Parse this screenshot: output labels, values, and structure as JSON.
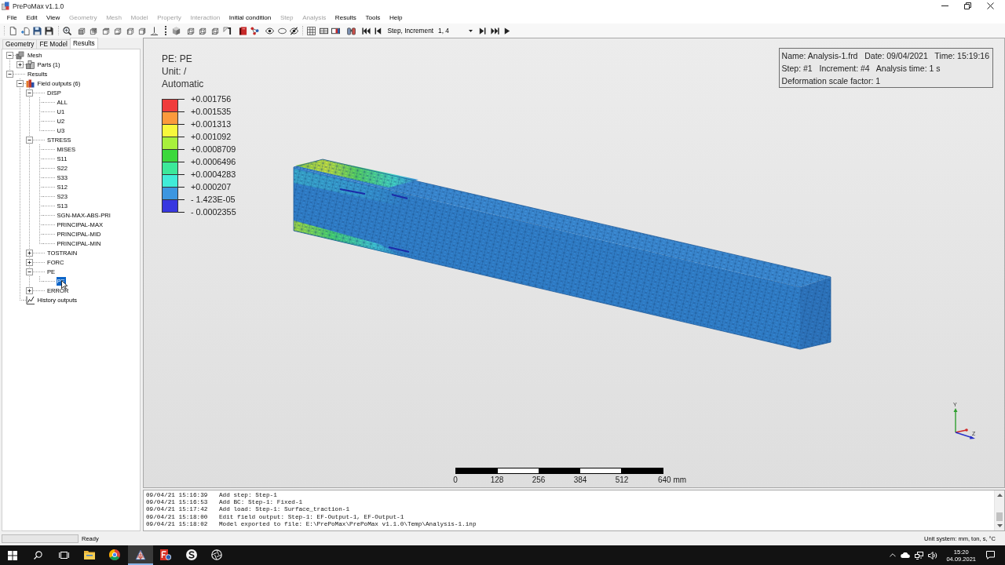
{
  "window": {
    "title": "PrePoMax v1.1.0"
  },
  "menu": [
    {
      "label": "File",
      "disabled": false
    },
    {
      "label": "Edit",
      "disabled": false
    },
    {
      "label": "View",
      "disabled": false
    },
    {
      "label": "Geometry",
      "disabled": true
    },
    {
      "label": "Mesh",
      "disabled": true
    },
    {
      "label": "Model",
      "disabled": true
    },
    {
      "label": "Property",
      "disabled": true
    },
    {
      "label": "Interaction",
      "disabled": true
    },
    {
      "label": "Initial condition",
      "disabled": false
    },
    {
      "label": "Step",
      "disabled": true
    },
    {
      "label": "Analysis",
      "disabled": true
    },
    {
      "label": "Results",
      "disabled": false
    },
    {
      "label": "Tools",
      "disabled": false
    },
    {
      "label": "Help",
      "disabled": false
    }
  ],
  "toolbar": {
    "step_label": "Step, Increment",
    "step_value": "1, 4"
  },
  "left_panel": {
    "tabs": [
      {
        "label": "Geometry",
        "selected": false
      },
      {
        "label": "FE Model",
        "selected": false
      },
      {
        "label": "Results",
        "selected": true
      }
    ],
    "tree": [
      {
        "label": "Mesh",
        "kind": "mesh",
        "expanded": true,
        "selected": false,
        "children": [
          {
            "label": "Parts (1)",
            "kind": "parts",
            "expanded": false,
            "selected": false
          }
        ]
      },
      {
        "label": "Results",
        "kind": "plain",
        "expanded": true,
        "selected": false,
        "children": [
          {
            "label": "Field outputs (6)",
            "kind": "fields",
            "expanded": true,
            "selected": false,
            "children": [
              {
                "label": "DISP",
                "kind": "plain",
                "expanded": true,
                "selected": false,
                "children": [
                  {
                    "label": "ALL",
                    "kind": "plain",
                    "selected": false
                  },
                  {
                    "label": "U1",
                    "kind": "plain",
                    "selected": false
                  },
                  {
                    "label": "U2",
                    "kind": "plain",
                    "selected": false
                  },
                  {
                    "label": "U3",
                    "kind": "plain",
                    "selected": false
                  }
                ]
              },
              {
                "label": "STRESS",
                "kind": "plain",
                "expanded": true,
                "selected": false,
                "children": [
                  {
                    "label": "MISES",
                    "kind": "plain",
                    "selected": false
                  },
                  {
                    "label": "S11",
                    "kind": "plain",
                    "selected": false
                  },
                  {
                    "label": "S22",
                    "kind": "plain",
                    "selected": false
                  },
                  {
                    "label": "S33",
                    "kind": "plain",
                    "selected": false
                  },
                  {
                    "label": "S12",
                    "kind": "plain",
                    "selected": false
                  },
                  {
                    "label": "S23",
                    "kind": "plain",
                    "selected": false
                  },
                  {
                    "label": "S13",
                    "kind": "plain",
                    "selected": false
                  },
                  {
                    "label": "SGN-MAX-ABS-PRI",
                    "kind": "plain",
                    "selected": false
                  },
                  {
                    "label": "PRINCIPAL-MAX",
                    "kind": "plain",
                    "selected": false
                  },
                  {
                    "label": "PRINCIPAL-MID",
                    "kind": "plain",
                    "selected": false
                  },
                  {
                    "label": "PRINCIPAL-MIN",
                    "kind": "plain",
                    "selected": false
                  }
                ]
              },
              {
                "label": "TOSTRAIN",
                "kind": "plain",
                "expanded": false,
                "selected": false
              },
              {
                "label": "FORC",
                "kind": "plain",
                "expanded": false,
                "selected": false
              },
              {
                "label": "PE",
                "kind": "plain",
                "expanded": true,
                "selected": false,
                "children": [
                  {
                    "label": "PE",
                    "kind": "plain",
                    "selected": true
                  }
                ]
              },
              {
                "label": "ERROR",
                "kind": "plain",
                "expanded": false,
                "selected": false
              }
            ]
          },
          {
            "label": "History outputs",
            "kind": "history",
            "selected": false
          }
        ]
      }
    ]
  },
  "viewport": {
    "legend": {
      "title": "PE: PE",
      "unit": "Unit: /",
      "mode": "Automatic",
      "values": [
        "+0.001756",
        "+0.001535",
        "+0.001313",
        "+0.001092",
        "+0.0008709",
        "+0.0006496",
        "+0.0004283",
        "+0.000207",
        "- 1.423E-05",
        "- 0.0002355"
      ],
      "bands": [
        {
          "color": "#f03c3c"
        },
        {
          "color": "#fb9a3c"
        },
        {
          "color": "#f8f83c"
        },
        {
          "color": "#a8f03c"
        },
        {
          "color": "#3cd83c"
        },
        {
          "color": "#3ce89a"
        },
        {
          "color": "#40ecd8"
        },
        {
          "color": "#3c96e0"
        },
        {
          "color": "#3838e0"
        }
      ]
    },
    "info": [
      "Name: Analysis-1.frd   Date: 09/04/2021   Time: 15:19:16",
      "Step: #1   Increment: #4   Analysis time: 1 s",
      "Deformation scale factor: 1"
    ],
    "axes": [
      "Y",
      "Z"
    ],
    "scale_bar": {
      "ticks": [
        "0",
        "128",
        "256",
        "384",
        "512",
        "640 mm"
      ]
    }
  },
  "log": [
    {
      "time": "09/04/21 15:16:39",
      "message": "Add step: Step-1"
    },
    {
      "time": "09/04/21 15:16:53",
      "message": "Add BC: Step-1: Fixed-1"
    },
    {
      "time": "09/04/21 15:17:42",
      "message": "Add load: Step-1: Surface_traction-1"
    },
    {
      "time": "09/04/21 15:18:00",
      "message": "Edit field output: Step-1: EF-Output-1, EF-Output-1"
    },
    {
      "time": "09/04/21 15:18:02",
      "message": "Model exported to file: E:\\PrePoMax\\PrePoMax v1.1.0\\Temp\\Analysis-1.inp"
    }
  ],
  "status_bar": {
    "progress": {
      "level": 0
    },
    "text": "Ready",
    "units": "Unit system: mm, ton, s, °C"
  },
  "taskbar": {
    "apps": [
      {
        "kind": "folder",
        "selected": false
      },
      {
        "kind": "wheel",
        "selected": false
      },
      {
        "kind": "mesher",
        "selected": true
      },
      {
        "kind": "editor",
        "selected": false
      },
      {
        "kind": "swirl",
        "selected": false
      },
      {
        "kind": "aperture",
        "selected": false
      }
    ],
    "time": "15:20",
    "date": "04.09.2021"
  }
}
